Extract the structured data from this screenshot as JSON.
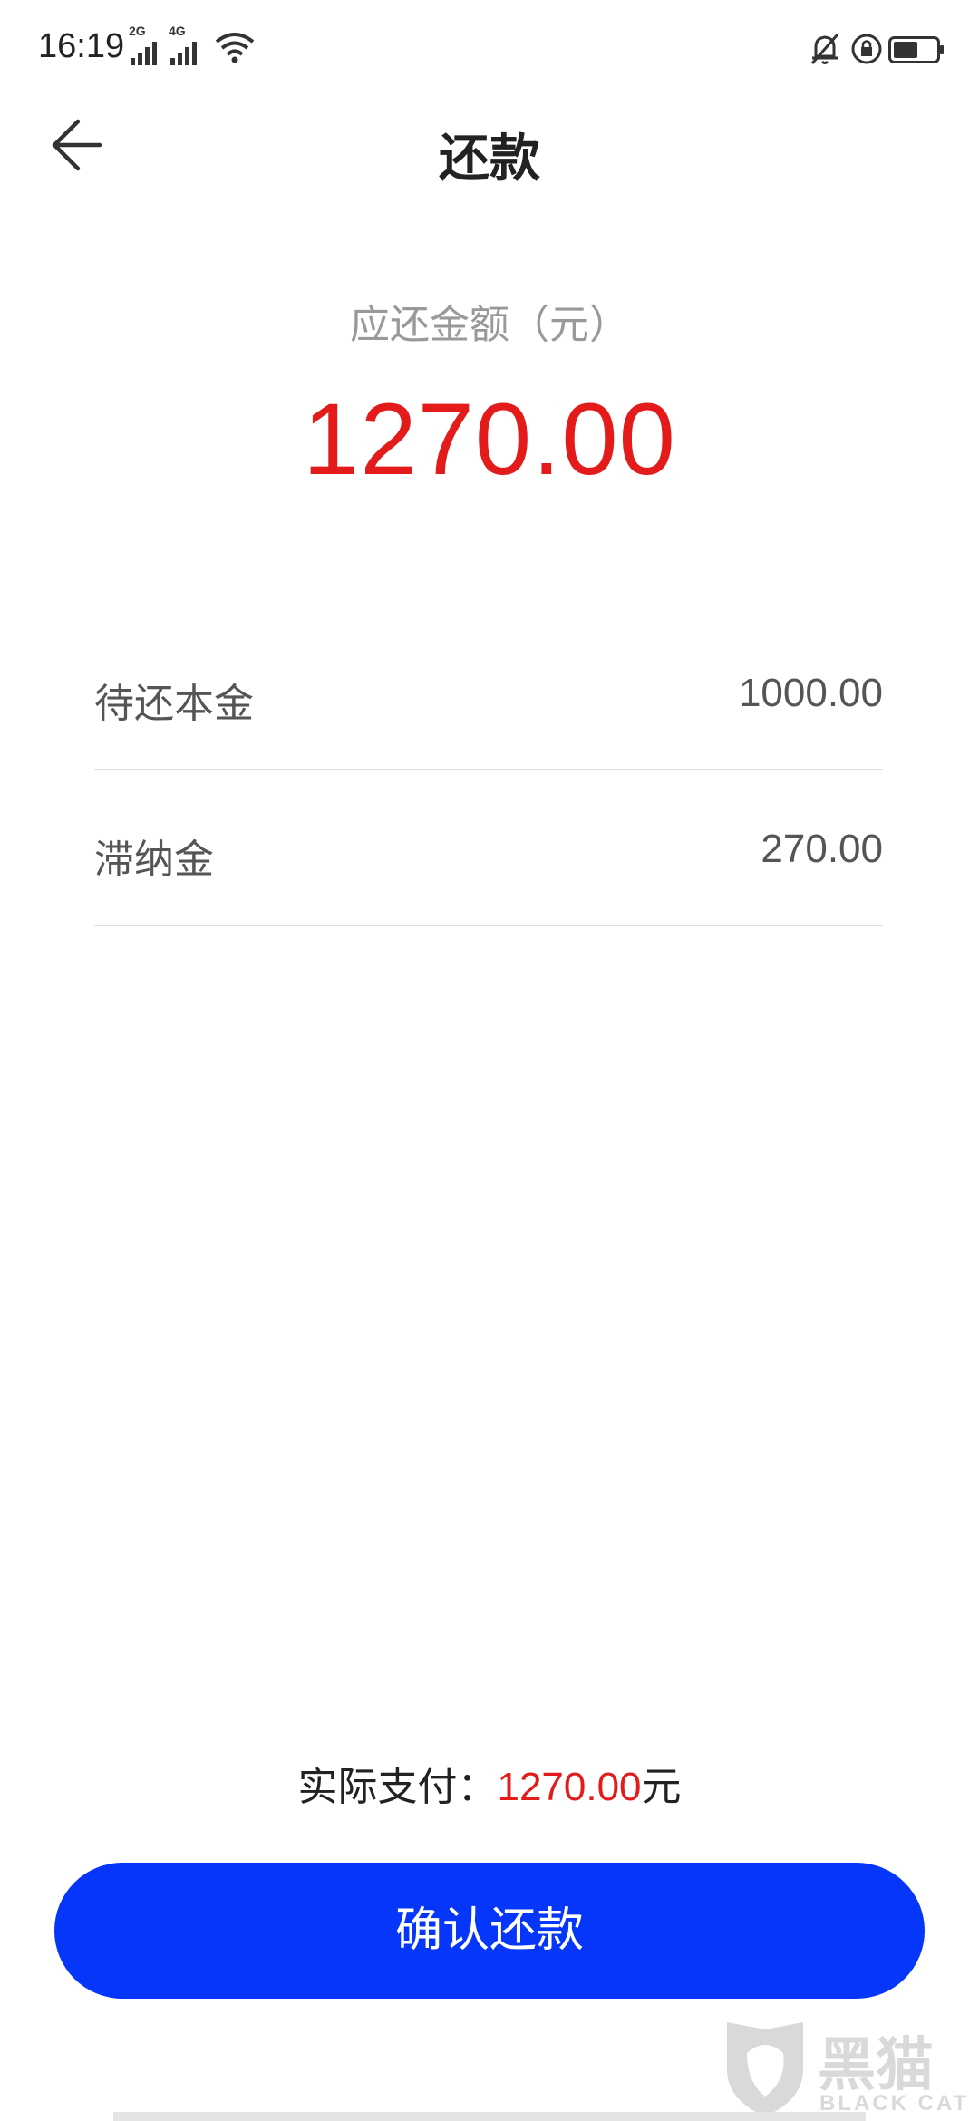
{
  "status_bar": {
    "time": "16:19",
    "signal_1_label": "2G",
    "signal_2_label": "4G",
    "icons": [
      "signal-icon",
      "wifi-icon",
      "mute-bell-icon",
      "rotation-lock-icon",
      "battery-icon"
    ]
  },
  "header": {
    "title": "还款",
    "back_icon": "arrow-left-icon"
  },
  "summary": {
    "due_label": "应还金额（元）",
    "due_amount": "1270.00"
  },
  "details": [
    {
      "label": "待还本金",
      "value": "1000.00"
    },
    {
      "label": "滞纳金",
      "value": "270.00"
    }
  ],
  "payment": {
    "actual_label": "实际支付：",
    "actual_amount": "1270.00",
    "actual_unit": "元"
  },
  "confirm": {
    "label": "确认还款"
  },
  "watermark": {
    "text": "黑猫",
    "sub": "BLACK CAT"
  },
  "colors": {
    "accent_red": "#e41b1b",
    "button_blue": "#0536fa"
  }
}
